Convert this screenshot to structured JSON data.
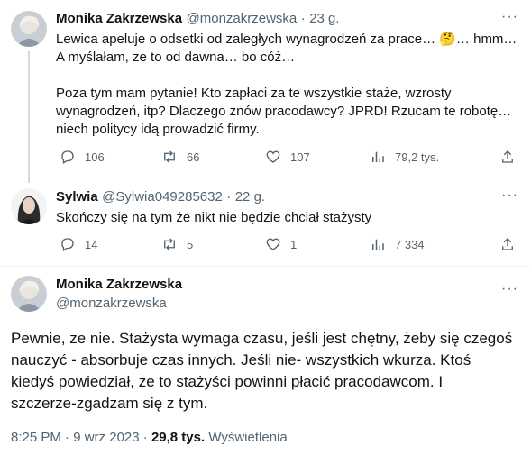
{
  "colors": {
    "text": "#0f1419",
    "muted": "#536471",
    "line": "#cfd9de"
  },
  "tweet1": {
    "name": "Monika Zakrzewska",
    "handle": "@monzakrzewska",
    "sep": "·",
    "time": "23 g.",
    "more": "···",
    "text": "Lewica apeluje o odsetki od zaległych wynagrodzeń za prace… 🤔… hmm…\nA myślałam, ze to od dawna… bo cóż…\n\nPoza tym mam pytanie! Kto zapłaci za te wszystkie staże, wzrosty\nwynagrodzeń, itp? Dlaczego znów pracodawcy? JPRD! Rzucam te robotę…\nniech politycy idą prowadzić firmy.",
    "replies": "106",
    "retweets": "66",
    "likes": "107",
    "views": "79,2 tys."
  },
  "tweet2": {
    "name": "Sylwia",
    "handle": "@Sylwia049285632",
    "sep": "·",
    "time": "22 g.",
    "more": "···",
    "text": "Skończy się na tym że nikt nie będzie chciał stażysty",
    "replies": "14",
    "retweets": "5",
    "likes": "1",
    "views": "7 334"
  },
  "main": {
    "name": "Monika Zakrzewska",
    "handle": "@monzakrzewska",
    "more": "···",
    "text": "Pewnie, ze nie. Stażysta wymaga czasu, jeśli jest chętny, żeby się czegoś\nnauczyć - absorbuje czas innych. Jeśli nie- wszystkich wkurza. Ktoś\nkiedyś powiedział, ze to stażyści powinni płacić pracodawcom. I\nszczerze-zgadzam się z tym.",
    "time": "8:25 PM",
    "sep": "·",
    "date": "9 wrz 2023",
    "sep2": "·",
    "views": "29,8 tys.",
    "views_label": "Wyświetlenia"
  }
}
